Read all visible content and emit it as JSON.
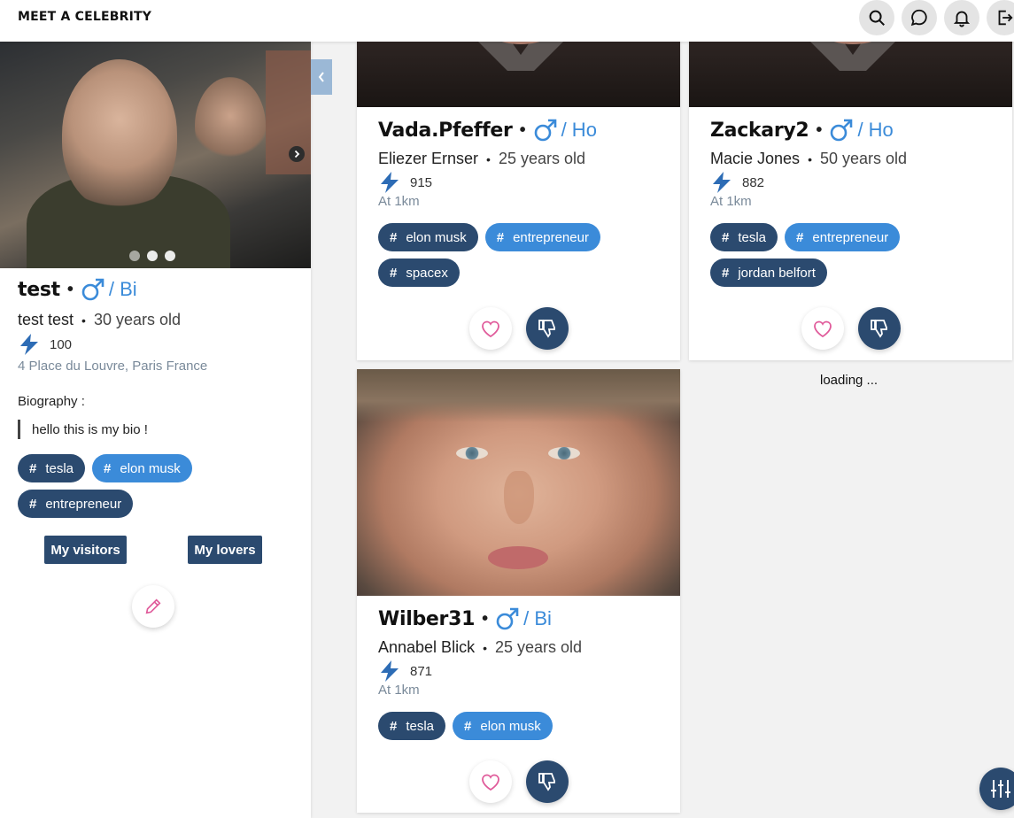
{
  "app": {
    "brand": "MEET A CELEBRITY"
  },
  "topbar": {
    "icons": [
      "search-icon",
      "chat-icon",
      "bell-icon",
      "logout-icon"
    ]
  },
  "profile": {
    "username": "test",
    "orientation": "/ Bi",
    "fullname": "test test",
    "age": "30 years old",
    "score": "100",
    "location": "4 Place du Louvre, Paris France",
    "bio_label": "Biography :",
    "bio": "hello this is my bio !",
    "tags": [
      {
        "label": "tesla",
        "style": "dark"
      },
      {
        "label": "elon musk",
        "style": "light"
      },
      {
        "label": "entrepreneur",
        "style": "dark"
      }
    ],
    "visitors_label": "My visitors",
    "lovers_label": "My lovers",
    "carousel": {
      "slides": 3,
      "active": 2
    }
  },
  "cards": [
    {
      "username": "Vada.Pfeffer",
      "orientation": "/ Ho",
      "fullname": "Eliezer Ernser",
      "age": "25 years old",
      "score": "915",
      "distance": "At 1km",
      "tags": [
        {
          "label": "elon musk",
          "style": "dark"
        },
        {
          "label": "entrepreneur",
          "style": "light"
        },
        {
          "label": "spacex",
          "style": "dark"
        }
      ]
    },
    {
      "username": "Zackary2",
      "orientation": "/ Ho",
      "fullname": "Macie Jones",
      "age": "50 years old",
      "score": "882",
      "distance": "At 1km",
      "tags": [
        {
          "label": "tesla",
          "style": "dark"
        },
        {
          "label": "entrepreneur",
          "style": "light"
        },
        {
          "label": "jordan belfort",
          "style": "dark"
        }
      ]
    },
    {
      "username": "Wilber31",
      "orientation": "/ Bi",
      "fullname": "Annabel Blick",
      "age": "25 years old",
      "score": "871",
      "distance": "At 1km",
      "tags": [
        {
          "label": "tesla",
          "style": "dark"
        },
        {
          "label": "elon musk",
          "style": "light"
        }
      ]
    }
  ],
  "loading_text": "loading ...",
  "colors": {
    "accent": "#3b8bd9",
    "dark_tag": "#2b4a6f",
    "like": "#e05a9a"
  }
}
